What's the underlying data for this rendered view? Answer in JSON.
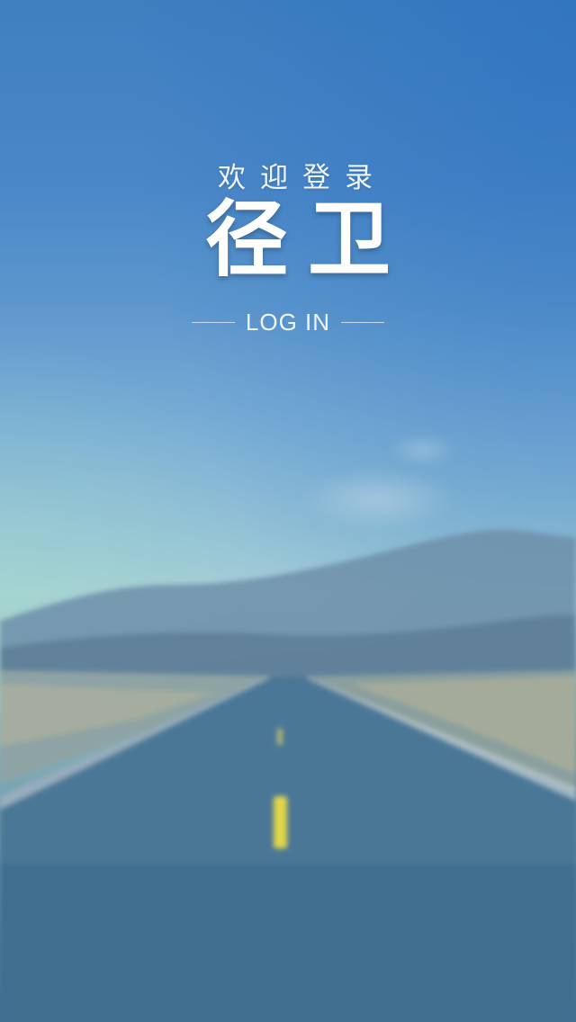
{
  "header": {
    "welcome_text": "欢迎登录",
    "brand_name": "径卫",
    "login_label": "LOG IN"
  },
  "colors": {
    "sky_top": "#3f7fc0",
    "sky_horizon": "#a3cdd6",
    "road": "#4b7796",
    "road_center_line": "#e0d64a",
    "text": "#ffffff"
  }
}
